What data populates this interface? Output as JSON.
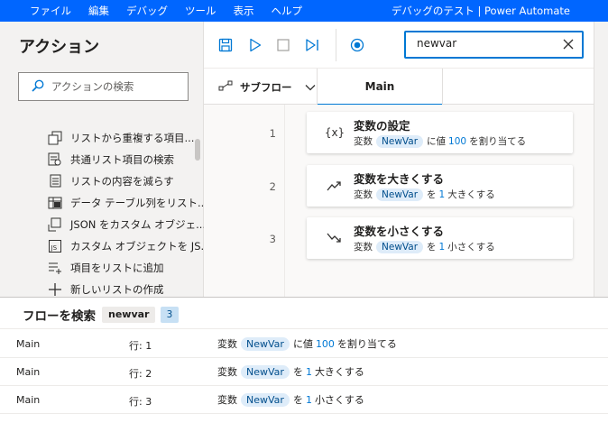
{
  "menu": [
    "ファイル",
    "編集",
    "デバッグ",
    "ツール",
    "表示",
    "ヘルプ"
  ],
  "app_title": "デバッグのテスト | Power Automate",
  "actions_pane": {
    "title": "アクション",
    "search_placeholder": "アクションの検索",
    "items": [
      {
        "label": "リストから重複する項目...",
        "icon": "list-duplicates-icon"
      },
      {
        "label": "共通リスト項目の検索",
        "icon": "list-common-icon"
      },
      {
        "label": "リストの内容を減らす",
        "icon": "list-subtract-icon"
      },
      {
        "label": "データ テーブル列をリスト...",
        "icon": "table-column-icon"
      },
      {
        "label": "JSON をカスタム オブジェ...",
        "icon": "json-convert-icon"
      },
      {
        "label": "カスタム オブジェクトを JS...",
        "icon": "js-file-icon"
      },
      {
        "label": "項目をリストに追加",
        "icon": "list-add-icon"
      },
      {
        "label": "新しいリストの作成",
        "icon": "plus-icon"
      }
    ]
  },
  "toolbar": {
    "search_value": "newvar"
  },
  "tabs": {
    "subflow_label": "サブフロー",
    "main_label": "Main"
  },
  "steps": [
    {
      "line": "1",
      "title": "変数の設定",
      "icon_text": "{x}",
      "prefix": "変数",
      "var": "NewVar",
      "mid": "に値",
      "value": "100",
      "suffix": "を割り当てる"
    },
    {
      "line": "2",
      "title": "変数を大きくする",
      "prefix": "変数",
      "var": "NewVar",
      "mid": "を",
      "value": "1",
      "suffix": "大きくする"
    },
    {
      "line": "3",
      "title": "変数を小さくする",
      "prefix": "変数",
      "var": "NewVar",
      "mid": "を",
      "value": "1",
      "suffix": "小さくする"
    }
  ],
  "results": {
    "title": "フローを検索",
    "term": "newvar",
    "count": "3",
    "rows": [
      {
        "flow": "Main",
        "line": "行: 1",
        "prefix": "変数",
        "var": "NewVar",
        "mid": "に値",
        "value": "100",
        "suffix": "を割り当てる"
      },
      {
        "flow": "Main",
        "line": "行: 2",
        "prefix": "変数",
        "var": "NewVar",
        "mid": "を",
        "value": "1",
        "suffix": "大きくする"
      },
      {
        "flow": "Main",
        "line": "行: 3",
        "prefix": "変数",
        "var": "NewVar",
        "mid": "を",
        "value": "1",
        "suffix": "小さくする"
      }
    ]
  }
}
